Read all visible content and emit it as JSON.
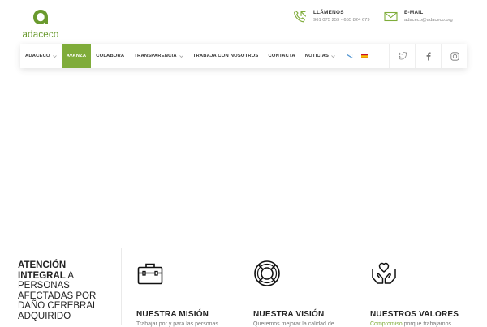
{
  "brand": {
    "name": "adaceco",
    "color": "#6a9a2e",
    "accent": "#7fac3a"
  },
  "contact": {
    "phone": {
      "icon": "phone-icon",
      "title": "LLÁMENOS",
      "value": "961 075 259 - 655 824 679"
    },
    "email": {
      "icon": "mail-icon",
      "title": "E-MAIL",
      "value": "adaceco@adaceco.org"
    }
  },
  "nav": {
    "items": [
      {
        "label": "ADACECO",
        "dropdown": true,
        "active": false
      },
      {
        "label": "AVANZA",
        "dropdown": false,
        "active": true
      },
      {
        "label": "COLABORA",
        "dropdown": false,
        "active": false
      },
      {
        "label": "TRANSPARENCIA",
        "dropdown": true,
        "active": false
      },
      {
        "label": "TRABAJA CON NOSOTROS",
        "dropdown": false,
        "active": false
      },
      {
        "label": "CONTACTA",
        "dropdown": false,
        "active": false
      },
      {
        "label": "NOTICIAS",
        "dropdown": true,
        "active": false
      }
    ],
    "flags": [
      "galician-flag-icon",
      "spanish-flag-icon"
    ],
    "social": [
      "twitter-icon",
      "facebook-icon",
      "instagram-icon"
    ]
  },
  "features": {
    "intro_bold": "ATENCIÓN INTEGRAL",
    "intro_rest": " A PERSONAS AFECTADAS POR DAÑO CEREBRAL ADQUIRIDO",
    "items": [
      {
        "icon": "briefcase-icon",
        "title": "NUESTRA MISIÓN",
        "text": "Trabajar por y para las personas",
        "highlight": ""
      },
      {
        "icon": "lifebuoy-icon",
        "title": "NUESTRA VISIÓN",
        "text": "Queremos mejorar la calidad de",
        "highlight": ""
      },
      {
        "icon": "heart-hands-icon",
        "title": "NUESTROS VALORES",
        "text": " porque trabajamos",
        "highlight": "Compromiso"
      }
    ]
  }
}
